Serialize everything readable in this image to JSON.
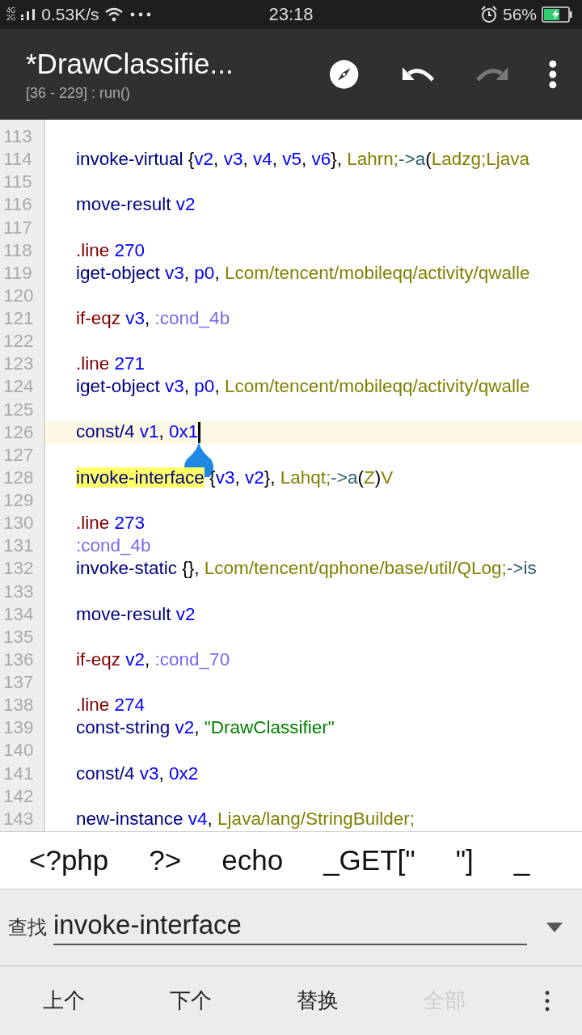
{
  "status_bar": {
    "networks": [
      "4G",
      "2G"
    ],
    "speed": "0.53K/s",
    "time": "23:18",
    "battery": "56%"
  },
  "toolbar": {
    "title": "*DrawClassifie...",
    "subtitle": "[36 - 229] : run()",
    "actions": [
      {
        "kind": "compass",
        "disabled": false
      },
      {
        "kind": "undo",
        "disabled": false
      },
      {
        "kind": "redo",
        "disabled": true
      },
      {
        "kind": "more",
        "disabled": false
      }
    ]
  },
  "editor": {
    "lines": [
      {
        "number": "113"
      },
      {
        "number": "114",
        "tokens": [
          {
            "text": "invoke-virtual",
            "kind": "op"
          },
          {
            "text": " {",
            "kind": "punct"
          },
          {
            "text": "v2",
            "kind": "reg"
          },
          {
            "text": ", ",
            "kind": "punct"
          },
          {
            "text": "v3",
            "kind": "reg"
          },
          {
            "text": ", ",
            "kind": "punct"
          },
          {
            "text": "v4",
            "kind": "reg"
          },
          {
            "text": ", ",
            "kind": "punct"
          },
          {
            "text": "v5",
            "kind": "reg"
          },
          {
            "text": ", ",
            "kind": "punct"
          },
          {
            "text": "v6",
            "kind": "reg"
          },
          {
            "text": "}, ",
            "kind": "punct"
          },
          {
            "text": "Lahrn;",
            "kind": "type"
          },
          {
            "text": "->a",
            "kind": "arrow"
          },
          {
            "text": "(",
            "kind": "punct"
          },
          {
            "text": "Ladzg;Ljava",
            "kind": "type"
          }
        ]
      },
      {
        "number": "115"
      },
      {
        "number": "116",
        "tokens": [
          {
            "text": "move-result",
            "kind": "op"
          },
          {
            "text": " v2",
            "kind": "reg"
          }
        ]
      },
      {
        "number": "117"
      },
      {
        "number": "118",
        "tokens": [
          {
            "text": ".line",
            "kind": "directive"
          },
          {
            "text": " 270",
            "kind": "reg"
          }
        ]
      },
      {
        "number": "119",
        "tokens": [
          {
            "text": "iget-object",
            "kind": "op"
          },
          {
            "text": " v3",
            "kind": "reg"
          },
          {
            "text": ", ",
            "kind": "punct"
          },
          {
            "text": "p0",
            "kind": "reg"
          },
          {
            "text": ", ",
            "kind": "punct"
          },
          {
            "text": "Lcom/tencent/mobileqq/activity/qwalle",
            "kind": "type"
          }
        ]
      },
      {
        "number": "120"
      },
      {
        "number": "121",
        "tokens": [
          {
            "text": "if-eqz",
            "kind": "directive"
          },
          {
            "text": " v3",
            "kind": "reg"
          },
          {
            "text": ", ",
            "kind": "punct"
          },
          {
            "text": ":cond_4b",
            "kind": "label"
          }
        ]
      },
      {
        "number": "122"
      },
      {
        "number": "123",
        "tokens": [
          {
            "text": ".line",
            "kind": "directive"
          },
          {
            "text": " 271",
            "kind": "reg"
          }
        ]
      },
      {
        "number": "124",
        "tokens": [
          {
            "text": "iget-object",
            "kind": "op"
          },
          {
            "text": " v3",
            "kind": "reg"
          },
          {
            "text": ", ",
            "kind": "punct"
          },
          {
            "text": "p0",
            "kind": "reg"
          },
          {
            "text": ", ",
            "kind": "punct"
          },
          {
            "text": "Lcom/tencent/mobileqq/activity/qwalle",
            "kind": "type"
          }
        ]
      },
      {
        "number": "125"
      },
      {
        "number": "126",
        "current": true,
        "tokens": [
          {
            "text": "const/4",
            "kind": "op"
          },
          {
            "text": " v1",
            "kind": "reg"
          },
          {
            "text": ", ",
            "kind": "punct"
          },
          {
            "text": "0x1",
            "kind": "reg"
          }
        ]
      },
      {
        "number": "127"
      },
      {
        "number": "128",
        "tokens": [
          {
            "text": "invoke-interface",
            "kind": "match"
          },
          {
            "text": " {",
            "kind": "punct"
          },
          {
            "text": "v3",
            "kind": "reg"
          },
          {
            "text": ", ",
            "kind": "punct"
          },
          {
            "text": "v2",
            "kind": "reg"
          },
          {
            "text": "}, ",
            "kind": "punct"
          },
          {
            "text": "Lahqt;",
            "kind": "type"
          },
          {
            "text": "->a",
            "kind": "arrow"
          },
          {
            "text": "(",
            "kind": "punct"
          },
          {
            "text": "Z",
            "kind": "type"
          },
          {
            "text": ")",
            "kind": "punct"
          },
          {
            "text": "V",
            "kind": "type"
          }
        ]
      },
      {
        "number": "129"
      },
      {
        "number": "130",
        "tokens": [
          {
            "text": ".line",
            "kind": "directive"
          },
          {
            "text": " 273",
            "kind": "reg"
          }
        ]
      },
      {
        "number": "131",
        "tokens": [
          {
            "text": ":cond_4b",
            "kind": "label"
          }
        ]
      },
      {
        "number": "132",
        "tokens": [
          {
            "text": "invoke-static",
            "kind": "op"
          },
          {
            "text": " {}, ",
            "kind": "punct"
          },
          {
            "text": "Lcom/tencent/qphone/base/util/QLog;",
            "kind": "type"
          },
          {
            "text": "->is",
            "kind": "arrow"
          }
        ]
      },
      {
        "number": "133"
      },
      {
        "number": "134",
        "tokens": [
          {
            "text": "move-result",
            "kind": "op"
          },
          {
            "text": " v2",
            "kind": "reg"
          }
        ]
      },
      {
        "number": "135"
      },
      {
        "number": "136",
        "tokens": [
          {
            "text": "if-eqz",
            "kind": "directive"
          },
          {
            "text": " v2",
            "kind": "reg"
          },
          {
            "text": ", ",
            "kind": "punct"
          },
          {
            "text": ":cond_70",
            "kind": "label"
          }
        ]
      },
      {
        "number": "137"
      },
      {
        "number": "138",
        "tokens": [
          {
            "text": ".line",
            "kind": "directive"
          },
          {
            "text": " 274",
            "kind": "reg"
          }
        ]
      },
      {
        "number": "139",
        "tokens": [
          {
            "text": "const-string",
            "kind": "op"
          },
          {
            "text": " v2",
            "kind": "reg"
          },
          {
            "text": ", ",
            "kind": "punct"
          },
          {
            "text": "\"DrawClassifier\"",
            "kind": "string"
          }
        ]
      },
      {
        "number": "140"
      },
      {
        "number": "141",
        "tokens": [
          {
            "text": "const/4",
            "kind": "op"
          },
          {
            "text": " v3",
            "kind": "reg"
          },
          {
            "text": ", ",
            "kind": "punct"
          },
          {
            "text": "0x2",
            "kind": "reg"
          }
        ]
      },
      {
        "number": "142"
      },
      {
        "number": "143",
        "tokens": [
          {
            "text": "new-instance",
            "kind": "op"
          },
          {
            "text": " v4",
            "kind": "reg"
          },
          {
            "text": ", ",
            "kind": "punct"
          },
          {
            "text": "Ljava/lang/StringBuilder;",
            "kind": "type"
          }
        ]
      }
    ]
  },
  "snippets": [
    "<?php",
    "?>",
    "echo",
    "_GET[\"",
    "\"]",
    "_"
  ],
  "find": {
    "label": "查找",
    "value": "invoke-interface"
  },
  "buttons": [
    {
      "label": "上个",
      "disabled": false
    },
    {
      "label": "下个",
      "disabled": false
    },
    {
      "label": "替换",
      "disabled": false
    },
    {
      "label": "全部",
      "disabled": true
    }
  ]
}
